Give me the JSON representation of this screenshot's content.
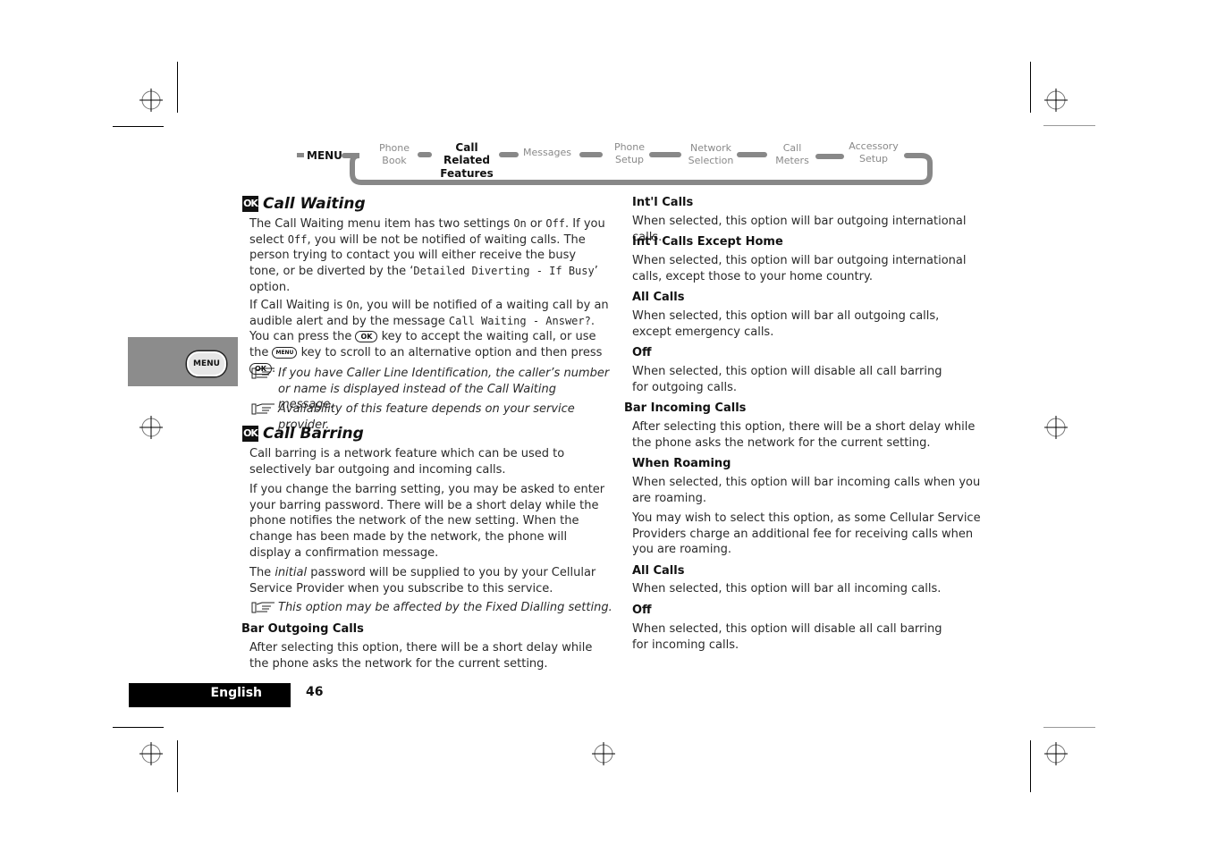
{
  "navigation": {
    "menu_label": "MENU",
    "items": [
      {
        "line1": "Phone",
        "line2": "Book",
        "active": false
      },
      {
        "line1": "Call Related",
        "line2": "Features",
        "active": true
      },
      {
        "line1": "Messages",
        "line2": "",
        "active": false
      },
      {
        "line1": "Phone",
        "line2": "Setup",
        "active": false
      },
      {
        "line1": "Network",
        "line2": "Selection",
        "active": false
      },
      {
        "line1": "Call",
        "line2": "Meters",
        "active": false
      },
      {
        "line1": "Accessory",
        "line2": "Setup",
        "active": false
      }
    ]
  },
  "side_tab": {
    "button_label": "MENU",
    "color": "#8c8c8c"
  },
  "left_column": {
    "call_waiting": {
      "icon": "OK",
      "title": "Call Waiting",
      "p1": {
        "a": "The Call Waiting menu item has two settings ",
        "on": "On",
        "b": " or ",
        "off": "Off",
        "c": ". If you select ",
        "off2": "Off",
        "d": ", you will be not be notified of waiting calls. The person trying to contact you will either receive the busy tone, or be diverted by the ‘",
        "option": "Detailed Diverting - If Busy",
        "e": "’ option."
      },
      "p2": {
        "a": "If Call Waiting is ",
        "on": "On",
        "b": ", you will be notified of a waiting call by an audible alert and by the message ",
        "message": "Call Waiting - Answer?",
        "c": ". You can press the ",
        "ok_key": "OK",
        "d": " key to accept the waiting call, or use the ",
        "menu_key": "MENU",
        "e": " key to scroll to an alternative option and then press ",
        "ok_key2": "OK",
        "f": "."
      },
      "note1": "If you have Caller Line Identification, the caller’s number or name is displayed instead of the Call Waiting message.",
      "note2": "Availability of this feature depends on your service provider."
    },
    "call_barring": {
      "icon": "OK",
      "title": "Call Barring",
      "p1": "Call barring is a network feature which can be used to selectively bar outgoing and incoming calls.",
      "p2": "If you change the barring setting, you may be asked to enter your barring password. There will be a short delay while the phone notifies the network of the new setting. When the change has been made by the network, the phone will display a confirmation message.",
      "p3": {
        "a": "The ",
        "em": "initial",
        "b": " password will be supplied to you by your Cellular Service Provider when you subscribe to this service."
      },
      "note": "This option may be affected by the Fixed Dialling setting."
    },
    "bar_outgoing": {
      "heading": "Bar Outgoing Calls",
      "text": "After selecting this option, there will be a short delay while the phone asks the network for the current setting."
    }
  },
  "right_column": {
    "outgoing_options": [
      {
        "heading": "Int'l Calls",
        "text": "When selected, this option will bar outgoing international calls."
      },
      {
        "heading": "Int'l Calls Except Home",
        "text": "When selected, this option will bar outgoing international calls, except those to your home country."
      },
      {
        "heading": "All Calls",
        "text": "When selected, this option will bar all outgoing calls, except emergency calls."
      },
      {
        "heading": "Off",
        "text": "When selected, this option will disable all call barring for outgoing calls."
      }
    ],
    "bar_incoming": {
      "heading": "Bar Incoming Calls",
      "text": "After selecting this option, there will be a short delay while the phone asks the network for the current setting."
    },
    "incoming_options": [
      {
        "heading": "When Roaming",
        "text": "When selected, this option will bar incoming calls when you are roaming.",
        "extra": "You may wish to select this option, as some Cellular Service Providers charge an additional fee for receiving calls when you are roaming."
      },
      {
        "heading": "All Calls",
        "text": "When selected, this option will bar all incoming calls."
      },
      {
        "heading": "Off",
        "text": "When selected, this option will disable all call barring for incoming calls."
      }
    ]
  },
  "footer": {
    "language": "English",
    "page_number": "46"
  }
}
